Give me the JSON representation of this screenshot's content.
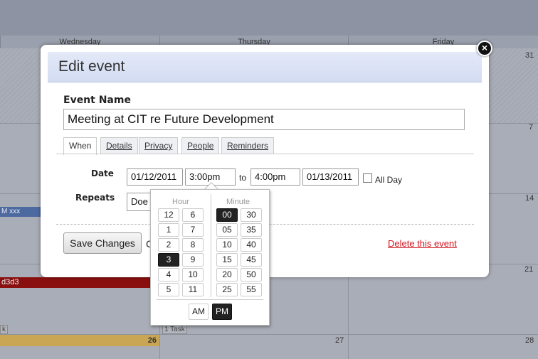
{
  "calendar": {
    "day_headers": [
      "Wednesday",
      "Thursday",
      "Friday"
    ],
    "day_numbers": {
      "r1_fri": "31",
      "r2_fri": "7",
      "r3_fri": "14",
      "r4_fri": "21",
      "r5_wed": "26",
      "r5_thu": "27",
      "r5_fri": "28"
    },
    "events": {
      "blue": "M xxx",
      "red": "d3d3",
      "prev": "k",
      "task": "1 Task"
    }
  },
  "dialog": {
    "title": "Edit event",
    "close_symbol": "×",
    "event_name_label": "Event Name",
    "event_name_value": "Meeting at CIT re Future Development",
    "tabs": [
      "When",
      "Details",
      "Privacy",
      "People",
      "Reminders"
    ],
    "date_label": "Date",
    "start_date": "01/12/2011",
    "start_time": "3:00pm",
    "to_label": "to",
    "end_time": "4:00pm",
    "end_date": "01/13/2011",
    "all_day_label": "All Day",
    "all_day_checked": false,
    "repeats_label": "Repeats",
    "repeats_value": "Doe",
    "save_label": "Save Changes",
    "cancel_fragment": "C",
    "delete_label": "Delete this event",
    "delete_color": "#d0141d"
  },
  "time_picker": {
    "hour_label": "Hour",
    "minute_label": "Minute",
    "hours": [
      "12",
      "6",
      "1",
      "7",
      "2",
      "8",
      "3",
      "9",
      "4",
      "10",
      "5",
      "11"
    ],
    "minutes": [
      "00",
      "30",
      "05",
      "35",
      "10",
      "40",
      "15",
      "45",
      "20",
      "50",
      "25",
      "55"
    ],
    "selected_hour": "3",
    "selected_minute": "00",
    "am_label": "AM",
    "pm_label": "PM",
    "selected_period": "PM"
  }
}
